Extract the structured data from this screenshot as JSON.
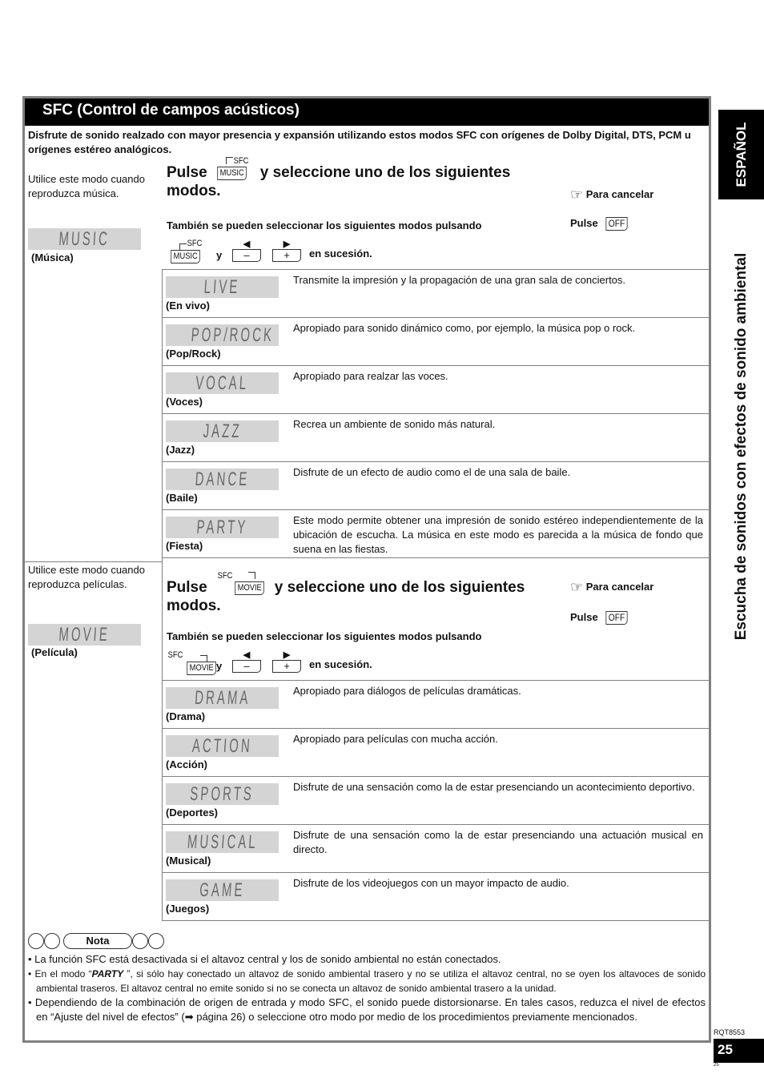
{
  "section_title": "SFC (Control de campos acústicos)",
  "intro": "Disfrute de sonido realzado con mayor presencia y expansión utilizando estos modos SFC  con orígenes de Dolby Digital, DTS, PCM u orígenes estéreo analógicos.",
  "common": {
    "pulse": "Pulse",
    "select_text": "y seleccione uno de los siguientes modos.",
    "cancel_label": "Para cancelar",
    "off_pulse": "Pulse",
    "off_button": "OFF",
    "also_text": "También se pueden seleccionar los siguientes modos pulsando",
    "y": "y",
    "minus": "–",
    "plus": "+",
    "left_arrow": "◀",
    "right_arrow": "▶",
    "in_sequence": "en sucesión.",
    "sfc": "SFC",
    "hand_icon": "☞"
  },
  "music": {
    "use_text": "Utilice este modo cuando reproduzca música.",
    "lcd": "MUSIC",
    "caption": "(Música)",
    "button": "MUSIC",
    "modes": [
      {
        "lcd": "LIVE",
        "caption": "(En vivo)",
        "desc": "Transmite la impresión y la propagación de una gran sala de conciertos."
      },
      {
        "lcd": "POP/ROCK",
        "caption": "(Pop/Rock)",
        "desc": "Apropiado para sonido dinámico como, por ejemplo, la música pop o rock."
      },
      {
        "lcd": "VOCAL",
        "caption": "(Voces)",
        "desc": "Apropiado para realzar las voces."
      },
      {
        "lcd": "JAZZ",
        "caption": "(Jazz)",
        "desc": "Recrea un ambiente de sonido más natural."
      },
      {
        "lcd": "DANCE",
        "caption": "(Baile)",
        "desc": "Disfrute de un efecto de audio como el de una sala de baile."
      },
      {
        "lcd": "PARTY",
        "caption": "(Fiesta)",
        "desc": "Este modo permite obtener una impresión de sonido estéreo independientemente de la ubicación de escucha. La música en este modo es parecida a la música de fondo que suena en las fiestas."
      }
    ]
  },
  "movie": {
    "use_text": "Utilice este modo cuando reproduzca películas.",
    "lcd": "MOVIE",
    "caption": "(Película)",
    "button": "MOVIE",
    "modes": [
      {
        "lcd": "DRAMA",
        "caption": "(Drama)",
        "desc": "Apropiado para diálogos de películas dramáticas."
      },
      {
        "lcd": "ACTION",
        "caption": "(Acción)",
        "desc": "Apropiado para películas con mucha acción."
      },
      {
        "lcd": "SPORTS",
        "caption": "(Deportes)",
        "desc": "Disfrute de una sensación como la de estar presenciando un acontecimiento deportivo."
      },
      {
        "lcd": "MUSICAL",
        "caption": "(Musical)",
        "desc": "Disfrute de una sensación como la de estar presenciando una actuación musical en directo."
      },
      {
        "lcd": "GAME",
        "caption": "(Juegos)",
        "desc": "Disfrute de los videojuegos con un mayor impacto de audio."
      }
    ]
  },
  "nota": {
    "label": "Nota",
    "items": [
      "• La función SFC está desactivada si el altavoz central y los de sonido ambiental no están conectados.",
      "•  En el modo “PARTY ”, si sólo hay conectado un altavoz de sonido ambiental trasero y no se utiliza el altavoz central, no se oyen los altavoces de sonido ambiental traseros. El altavoz central no emite sonido si no se conecta un altavoz de sonido ambiental trasero a la unidad.",
      "• Dependiendo de la combinación de origen de entrada y modo SFC, el sonido puede distorsionarse. En tales casos, reduzca el nivel de efectos en “Ajuste del nivel de efectos” (➡ página 26) o seleccione otro modo por medio de los procedimientos previamente mencionados."
    ]
  },
  "side": {
    "language_tab": "ESPAÑOL",
    "chapter_title": "Escucha de sonidos con efectos de sonido ambiental"
  },
  "footer": {
    "doc_code": "RQT8553",
    "page_number": "25",
    "page_tiny": "25"
  }
}
